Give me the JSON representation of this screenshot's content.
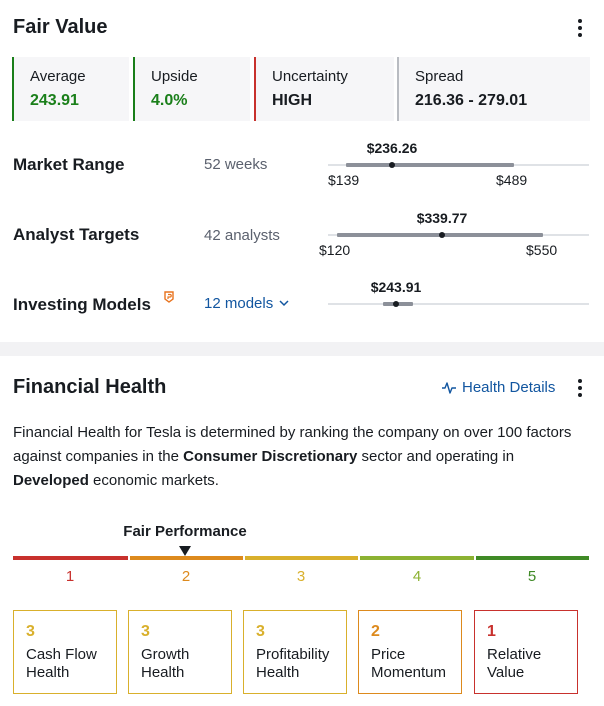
{
  "fair_value": {
    "title": "Fair Value",
    "metrics": [
      {
        "label": "Average",
        "value": "243.91",
        "color": "#1a7f1a"
      },
      {
        "label": "Upside",
        "value": "4.0%",
        "color": "#1a7f1a"
      },
      {
        "label": "Uncertainty",
        "value": "HIGH",
        "color": "#181c21"
      },
      {
        "label": "Spread",
        "value": "216.36 - 279.01",
        "color": "#181c21"
      }
    ],
    "rows": [
      {
        "title": "Market Range",
        "sub": "52 weeks",
        "current": "$236.26",
        "low": "$139",
        "high": "$489"
      },
      {
        "title": "Analyst Targets",
        "sub": "42 analysts",
        "current": "$339.77",
        "low": "$120",
        "high": "$550"
      },
      {
        "title": "Investing Models",
        "link": "12 models",
        "current": "$243.91"
      }
    ]
  },
  "financial_health": {
    "title": "Financial Health",
    "details_link": "Health Details",
    "desc": {
      "p1": "Financial Health for Tesla is determined by ranking the company on over 100 factors against companies in the ",
      "sector": "Consumer Discretionary",
      "p2": " sector and operating in ",
      "market": "Developed",
      "p3": " economic markets."
    },
    "performance_label": "Fair Performance",
    "performance_level": 2,
    "scale": [
      {
        "num": "1",
        "color": "#c8312d"
      },
      {
        "num": "2",
        "color": "#dd8a1d"
      },
      {
        "num": "3",
        "color": "#d9b02c"
      },
      {
        "num": "4",
        "color": "#8cb232"
      },
      {
        "num": "5",
        "color": "#3f8a26"
      }
    ],
    "scores": [
      {
        "num": "3",
        "line1": "Cash Flow",
        "line2": "Health",
        "color": "#d9b02c"
      },
      {
        "num": "3",
        "line1": "Growth",
        "line2": "Health",
        "color": "#d9b02c"
      },
      {
        "num": "3",
        "line1": "Profitability",
        "line2": "Health",
        "color": "#d9b02c"
      },
      {
        "num": "2",
        "line1": "Price",
        "line2": "Momentum",
        "color": "#dd8a1d"
      },
      {
        "num": "1",
        "line1": "Relative",
        "line2": "Value",
        "color": "#c8312d"
      }
    ]
  }
}
